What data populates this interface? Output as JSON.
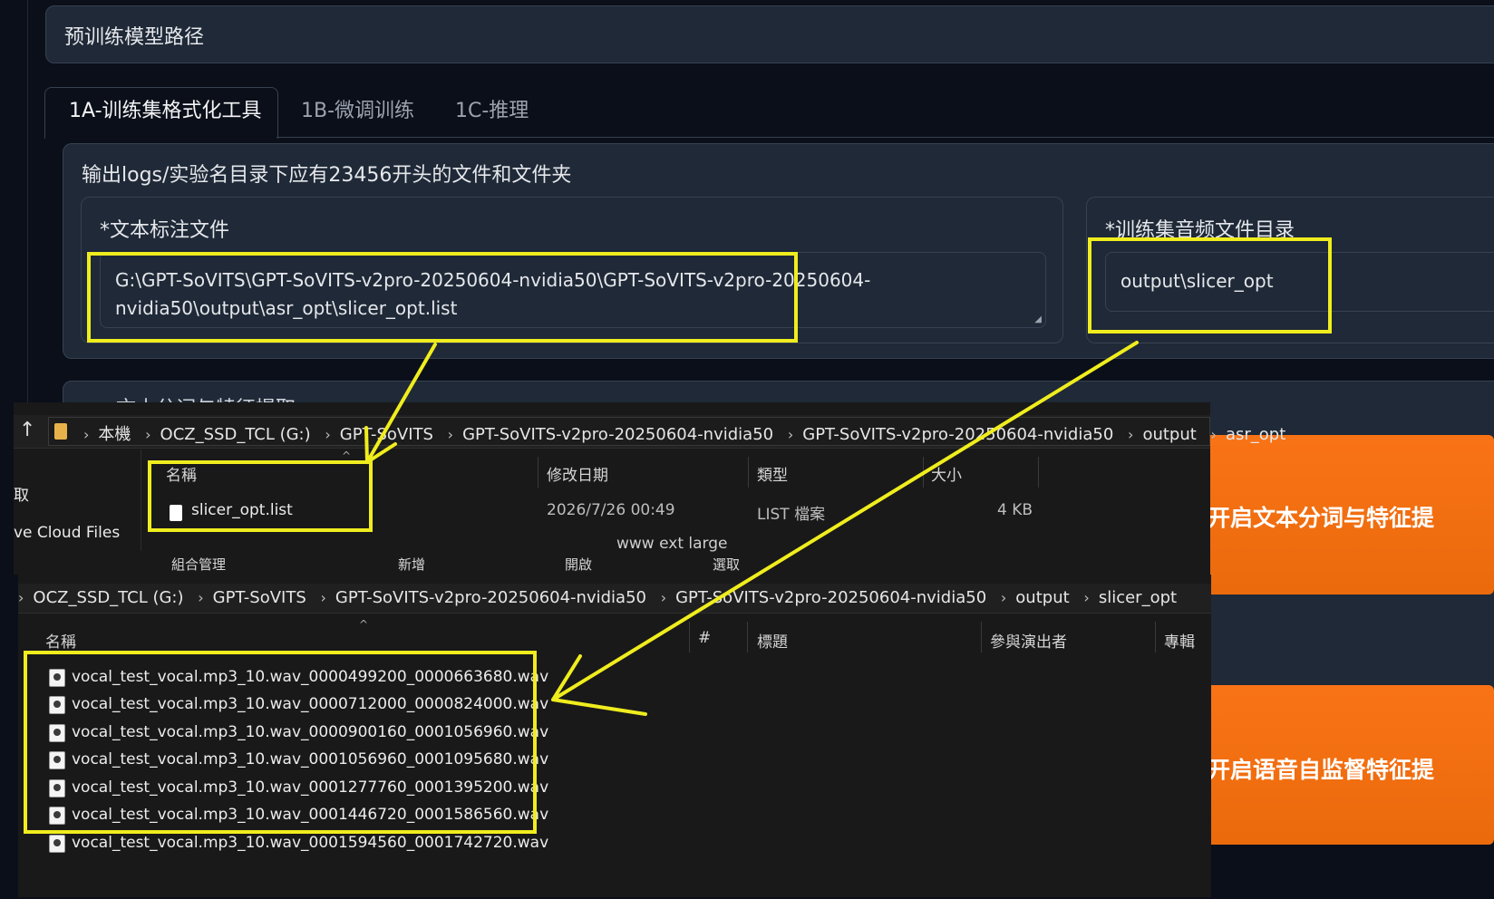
{
  "pretrained_bar": {
    "label": "预训练模型路径"
  },
  "tabs": [
    {
      "label": "1A-训练集格式化工具"
    },
    {
      "label": "1B-微调训练"
    },
    {
      "label": "1C-推理"
    }
  ],
  "info_text": "输出logs/实验名目录下应有23456开头的文件和文件夹",
  "text_annot": {
    "label": "*文本标注文件",
    "value_line1": "G:\\GPT-SoVITS\\GPT-SoVITS-v2pro-20250604-nvidia50\\GPT-SoVITS-v2pro-20250604-",
    "value_line2": "nvidia50\\output\\asr_opt\\slicer_opt.list"
  },
  "audio_dir": {
    "label": "*训练集音频文件目录",
    "value": "output\\slicer_opt"
  },
  "partial_section_title": "一文本分词与特征提取",
  "buttons": {
    "text_feature": "开启文本分词与特征提",
    "ssl_feature": "开启语音自监督特征提"
  },
  "explorer_top": {
    "breadcrumb": [
      "本機",
      "OCZ_SSD_TCL (G:)",
      "GPT-SoVITS",
      "GPT-SoVITS-v2pro-20250604-nvidia50",
      "GPT-SoVITS-v2pro-20250604-nvidia50",
      "output",
      "asr_opt"
    ],
    "side_items": [
      "取",
      "ve Cloud Files"
    ],
    "columns": [
      "名稱",
      "修改日期",
      "類型",
      "大小"
    ],
    "file": {
      "name": "slicer_opt.list",
      "modified": "2026/7/26 00:49",
      "type": "LIST 檔案",
      "size": "4 KB"
    },
    "overlay_text": "www ext large",
    "ribbon": [
      "組合管理",
      "新增",
      "開啟",
      "選取"
    ]
  },
  "explorer_bottom": {
    "breadcrumb": [
      "OCZ_SSD_TCL (G:)",
      "GPT-SoVITS",
      "GPT-SoVITS-v2pro-20250604-nvidia50",
      "GPT-SoVITS-v2pro-20250604-nvidia50",
      "output",
      "slicer_opt"
    ],
    "columns": [
      "名稱",
      "#",
      "標題",
      "參與演出者",
      "專輯"
    ],
    "files": [
      "vocal_test_vocal.mp3_10.wav_0000499200_0000663680.wav",
      "vocal_test_vocal.mp3_10.wav_0000712000_0000824000.wav",
      "vocal_test_vocal.mp3_10.wav_0000900160_0001056960.wav",
      "vocal_test_vocal.mp3_10.wav_0001056960_0001095680.wav",
      "vocal_test_vocal.mp3_10.wav_0001277760_0001395200.wav",
      "vocal_test_vocal.mp3_10.wav_0001446720_0001586560.wav",
      "vocal_test_vocal.mp3_10.wav_0001594560_0001742720.wav"
    ]
  },
  "colors": {
    "annotation": "#f0ed1e",
    "accent": "#f97316"
  }
}
